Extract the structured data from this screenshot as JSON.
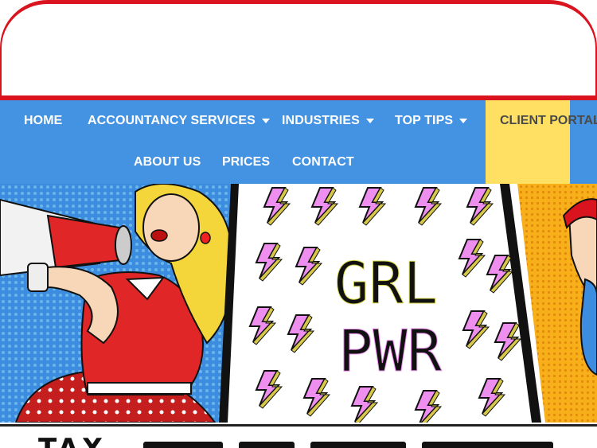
{
  "nav": {
    "home": "HOME",
    "accountancy": "ACCOUNTANCY SERVICES",
    "industries": "INDUSTRIES",
    "top_tips": "TOP TIPS",
    "client_portal": "CLIENT PORTAL",
    "about": "ABOUT US",
    "prices": "PRICES",
    "contact": "CONTACT"
  },
  "banner": {
    "poster_line1": "GRL",
    "poster_line2": "PWR"
  },
  "below_banner": {
    "heading_start": "TAX"
  },
  "colors": {
    "nav_bg": "#4493e3",
    "accent_red": "#d9141e",
    "portal_bg": "#ffe063",
    "poster_bolt": "#ee8ff0"
  }
}
